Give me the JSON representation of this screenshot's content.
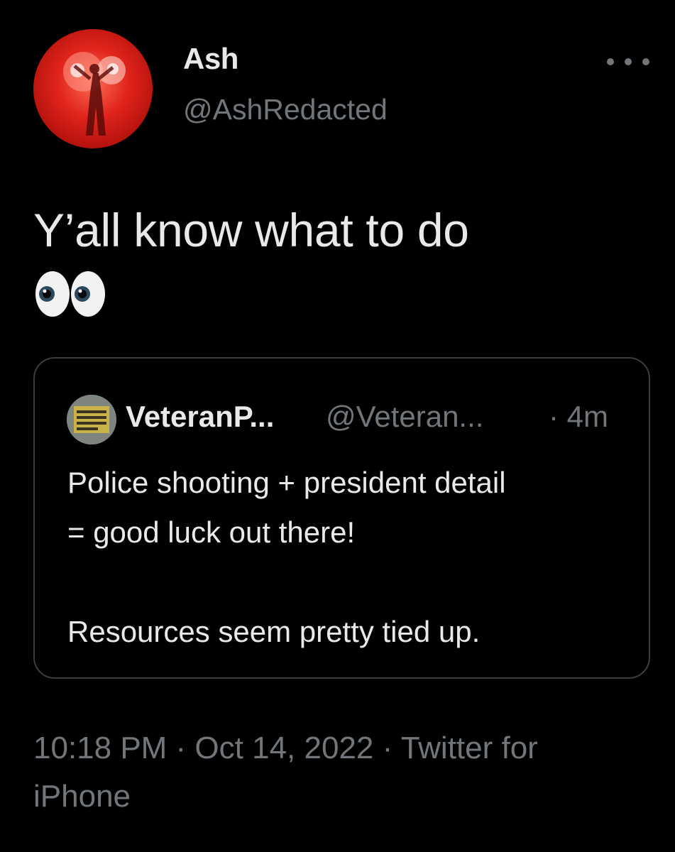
{
  "author": {
    "display_name": "Ash",
    "handle": "@AshRedacted",
    "avatar_icon": "profile-avatar-red-photo"
  },
  "more_icon": "more-options-icon",
  "tweet": {
    "text": "Y’all know what to do",
    "emoji": "eyes-emoji"
  },
  "quoted_tweet": {
    "display_name": "VeteranP...",
    "handle": "@Veteran...",
    "time": "· 4m",
    "line1": "Police shooting + president detail",
    "line2": "= good luck out there!",
    "line3": "Resources seem pretty tied up."
  },
  "meta": {
    "timestamp": "10:18 PM · Oct 14, 2022 · Twitter for iPhone"
  },
  "colors": {
    "background": "#000000",
    "primary_text": "#e7e9ea",
    "secondary_text": "#71767b",
    "card_border": "#3a3d41"
  }
}
